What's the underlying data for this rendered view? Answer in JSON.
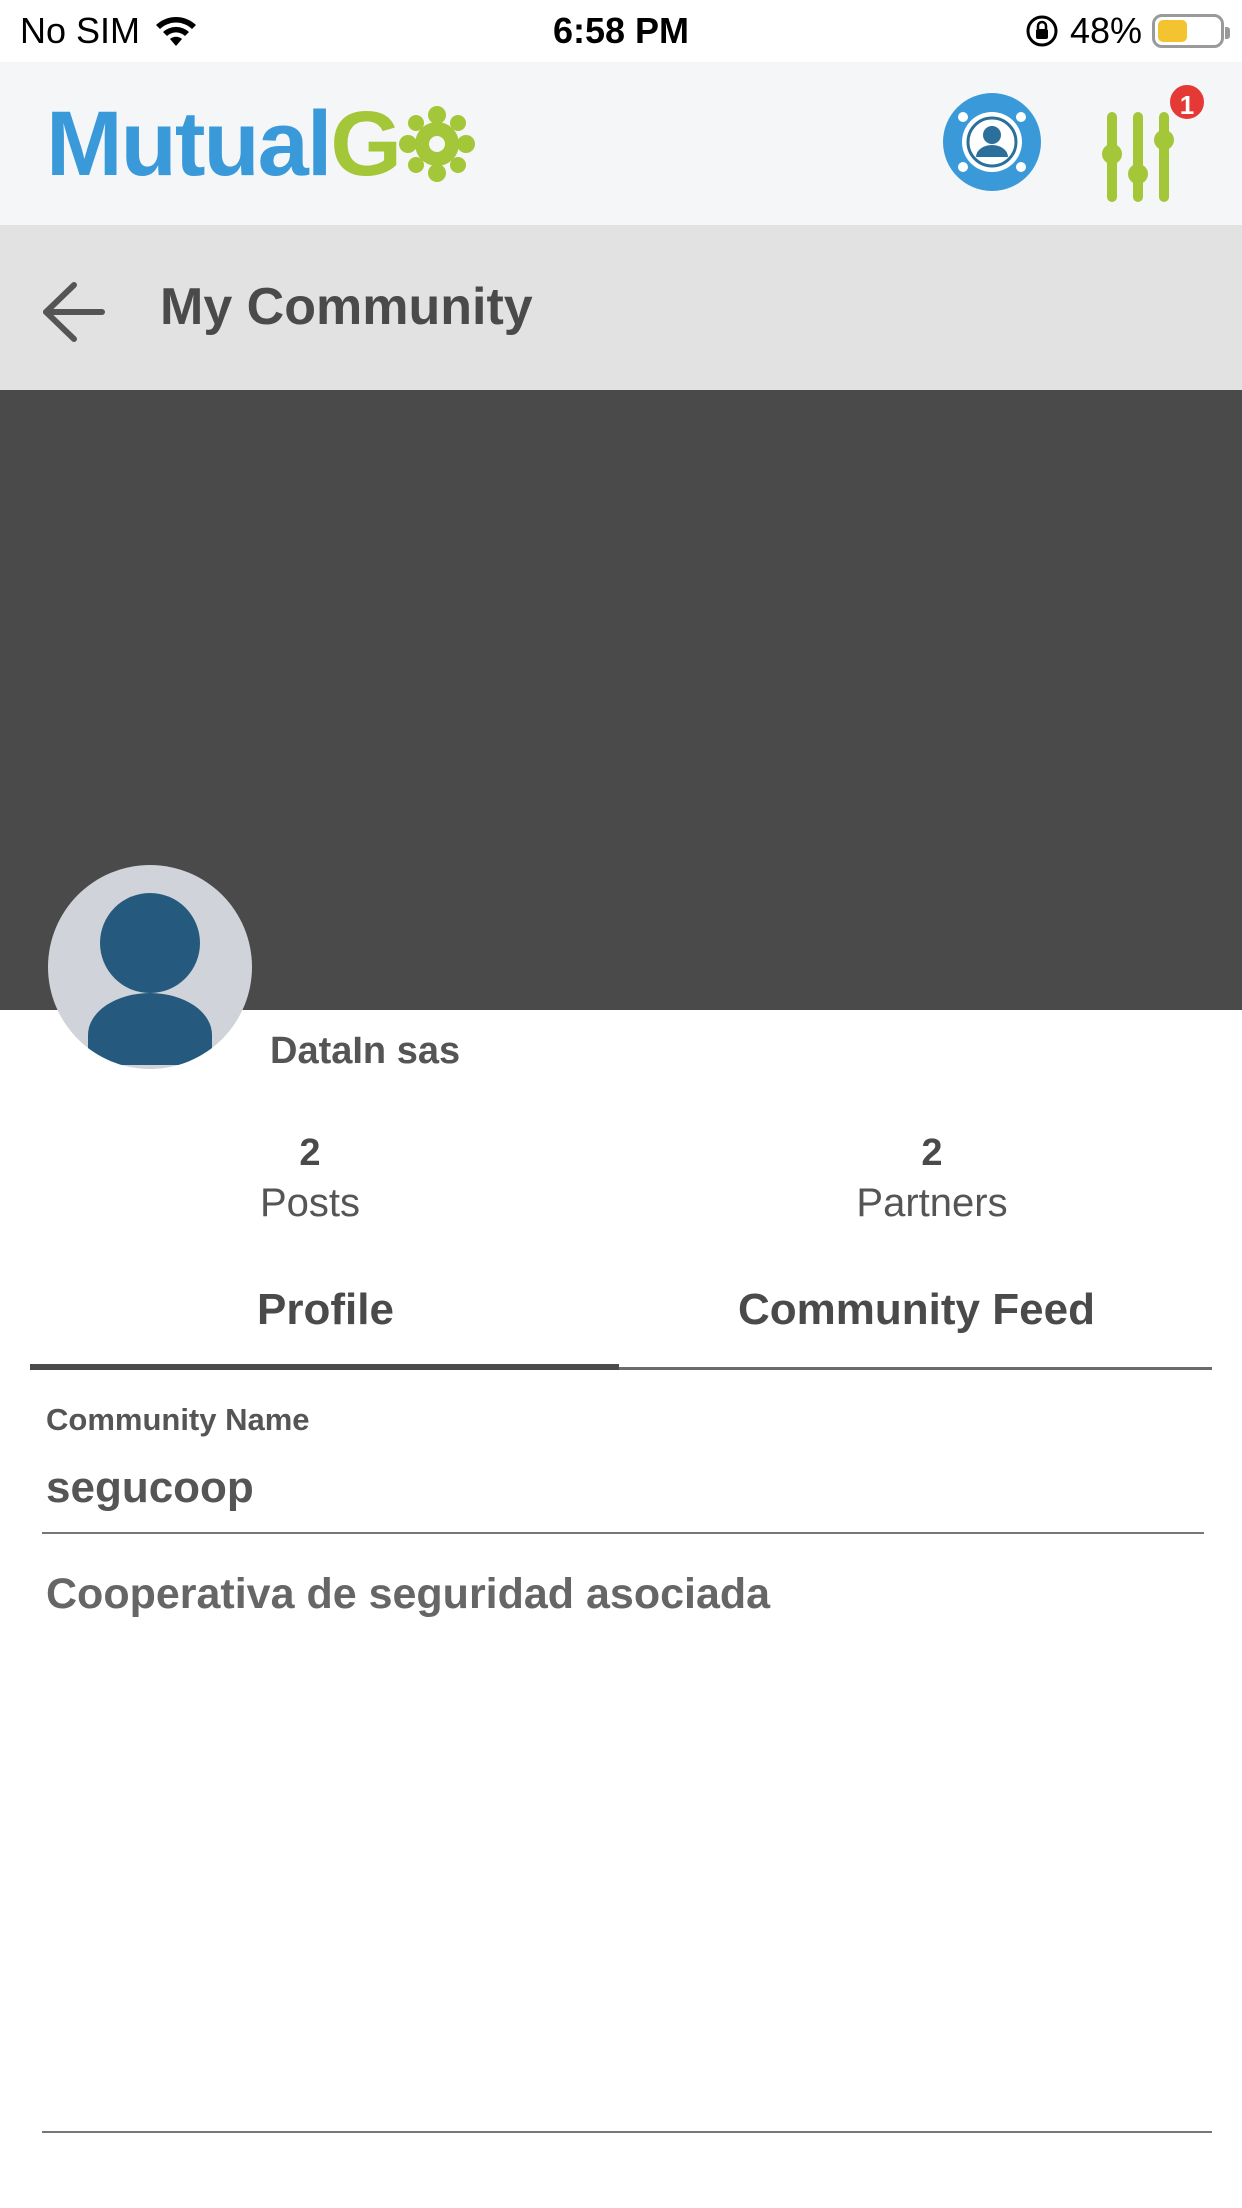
{
  "status_bar": {
    "carrier": "No SIM",
    "time": "6:58 PM",
    "battery_percent": "48%",
    "battery_level": 0.48
  },
  "header": {
    "logo_part1": "Mutual",
    "logo_part2": "G",
    "notification_count": "1",
    "colors": {
      "logo_blue": "#3a9ad9",
      "logo_green": "#a4c639",
      "badge_red": "#e53935"
    }
  },
  "title_bar": {
    "title": "My Community"
  },
  "profile": {
    "company_name": "DataIn sas",
    "stats": {
      "posts_value": "2",
      "posts_label": "Posts",
      "partners_value": "2",
      "partners_label": "Partners"
    }
  },
  "tabs": [
    {
      "label": "Profile",
      "active": true
    },
    {
      "label": "Community Feed",
      "active": false
    }
  ],
  "form": {
    "community_name_label": "Community Name",
    "community_name_value": "segucoop",
    "description": "Cooperativa de seguridad asociada"
  }
}
